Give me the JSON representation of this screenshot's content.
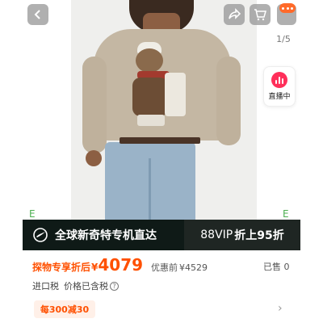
{
  "header": {
    "back_icon": "chevron-left-icon",
    "share_icon": "share-icon",
    "cart_icon": "cart-icon",
    "more_icon": "more-dots-icon",
    "pager": "1/5"
  },
  "live": {
    "label": "直播中",
    "icon": "live-chart-icon",
    "color": "#ff2f5a"
  },
  "banner": {
    "left_text": "全球新奇特专机直达",
    "right_label": "88VIP",
    "right_offer": "折上95折",
    "logo_icon": "plane-swoosh-icon"
  },
  "price": {
    "prefix": "探物专享折后",
    "currency": "¥",
    "value": "4079",
    "orig_label": "优惠前",
    "orig_price": "¥4529",
    "sold": "已售 0",
    "accent_color": "#ff5000"
  },
  "tax": {
    "label": "进口税",
    "detail": "价格已含税",
    "info_icon": "question-circle-icon"
  },
  "coupon": {
    "label": "每300减30",
    "chevron_icon": "chevron-right-icon"
  },
  "corners": {
    "left": "E",
    "right": "E"
  }
}
